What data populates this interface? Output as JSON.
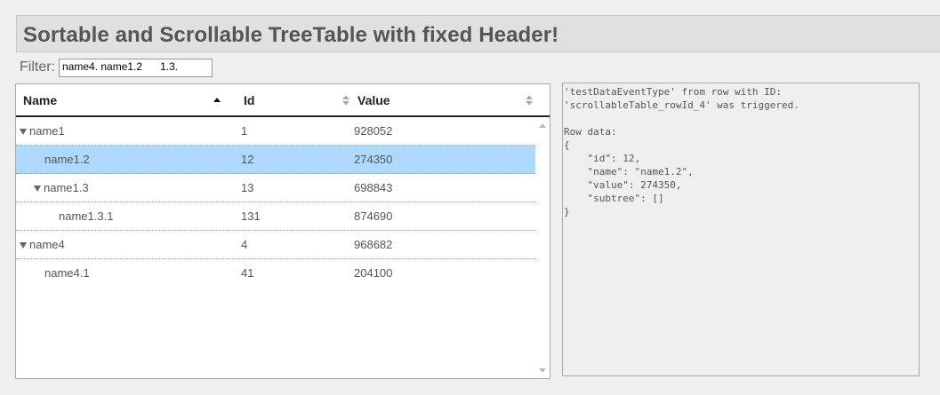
{
  "page": {
    "title": "Sortable and Scrollable TreeTable with fixed Header!"
  },
  "filter": {
    "label": "Filter:",
    "value": "name4. name1.2      1.3."
  },
  "table": {
    "columns": [
      {
        "label": "Name",
        "sort": "ascending"
      },
      {
        "label": "Id",
        "sort": "unsorted"
      },
      {
        "label": "Value",
        "sort": "unsorted"
      }
    ],
    "rows": [
      {
        "name": "name1",
        "id": "1",
        "value": "928052",
        "depth": 0,
        "expanded": true,
        "selected": false
      },
      {
        "name": "name1.2",
        "id": "12",
        "value": "274350",
        "depth": 1,
        "expanded": false,
        "selected": true
      },
      {
        "name": "name1.3",
        "id": "13",
        "value": "698843",
        "depth": 1,
        "expanded": true,
        "selected": false
      },
      {
        "name": "name1.3.1",
        "id": "131",
        "value": "874690",
        "depth": 2,
        "expanded": false,
        "selected": false
      },
      {
        "name": "name4",
        "id": "4",
        "value": "968682",
        "depth": 0,
        "expanded": true,
        "selected": false
      },
      {
        "name": "name4.1",
        "id": "41",
        "value": "204100",
        "depth": 1,
        "expanded": false,
        "selected": false
      }
    ]
  },
  "event_log": {
    "text": "'testDataEventType' from row with ID:\n'scrollableTable_rowId_4' was triggered.\n\nRow data:\n{\n    \"id\": 12,\n    \"name\": \"name1.2\",\n    \"value\": 274350,\n    \"subtree\": []\n}"
  },
  "colors": {
    "selected_row": "#aed8fc",
    "header_border": "#222222",
    "title_bar": "#e0e0e0"
  },
  "icons": {
    "sort_ascending": "sort-ascending-icon",
    "sort_unsorted": "sort-both-icon",
    "expanded": "caret-down-icon",
    "scroll_up": "scroll-up-arrow-icon",
    "scroll_down": "scroll-down-arrow-icon"
  }
}
